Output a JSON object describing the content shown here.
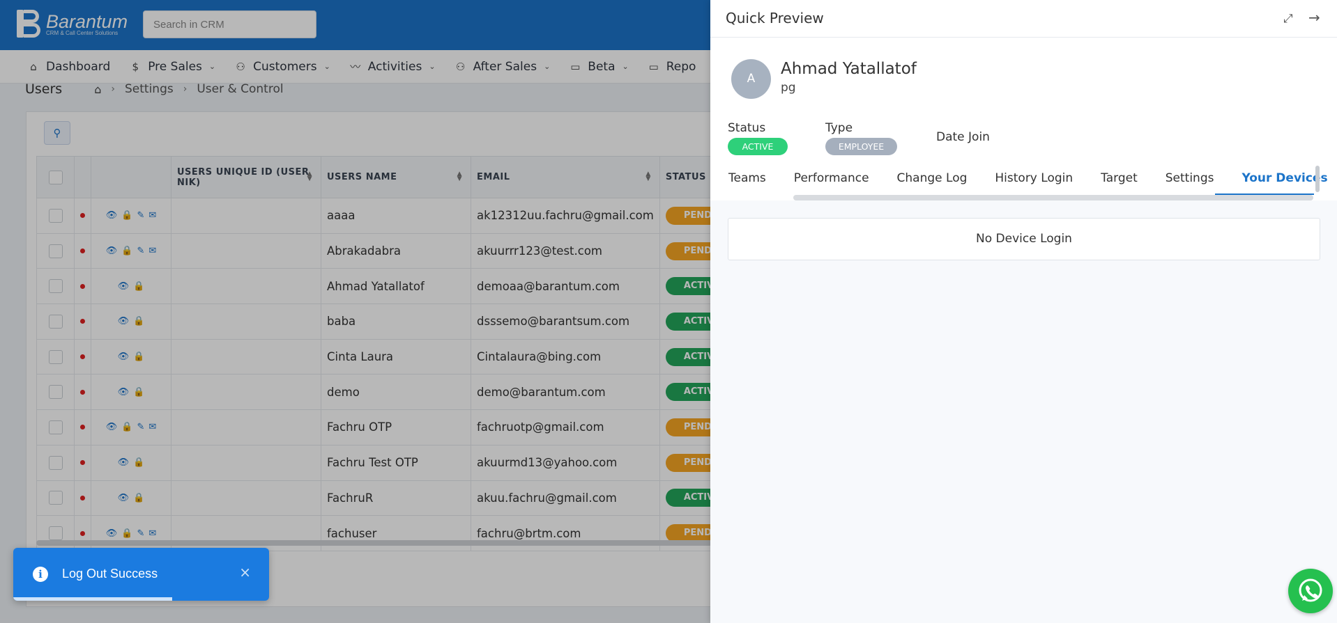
{
  "brand": {
    "name": "Barantum",
    "tagline": "CRM & Call Center Solutions"
  },
  "search": {
    "placeholder": "Search in CRM"
  },
  "nav": {
    "items": [
      {
        "label": "Dashboard",
        "icon": "home-icon",
        "glyph": "⌂",
        "caret": false
      },
      {
        "label": "Pre Sales",
        "icon": "dollar-icon",
        "glyph": "$",
        "caret": true
      },
      {
        "label": "Customers",
        "icon": "users-icon",
        "glyph": "⚇",
        "caret": true
      },
      {
        "label": "Activities",
        "icon": "activity-icon",
        "glyph": "〰",
        "caret": true
      },
      {
        "label": "After Sales",
        "icon": "user-service-icon",
        "glyph": "⚇",
        "caret": true
      },
      {
        "label": "Beta",
        "icon": "folder-icon",
        "glyph": "▭",
        "caret": true
      },
      {
        "label": "Repo",
        "icon": "folder-icon",
        "glyph": "▭",
        "caret": false
      }
    ]
  },
  "breadcrumb": {
    "title": "Users",
    "items": [
      "Settings",
      "User & Control"
    ]
  },
  "table": {
    "headers": [
      "USERS UNIQUE ID (USER NIK)",
      "USERS NAME",
      "EMAIL",
      "STATUS"
    ],
    "rows": [
      {
        "name": "aaaa",
        "email": "ak12312uu.fachru@gmail.com",
        "status": "PENDING",
        "status_type": "pending",
        "full_actions": true
      },
      {
        "name": "Abrakadabra",
        "email": "akuurrr123@test.com",
        "status": "PENDING",
        "status_type": "pending",
        "full_actions": true
      },
      {
        "name": "Ahmad Yatallatof",
        "email": "demoaa@barantum.com",
        "status": "ACTIVE",
        "status_type": "active",
        "full_actions": false
      },
      {
        "name": "baba",
        "email": "dsssemo@barantsum.com",
        "status": "ACTIVE",
        "status_type": "active",
        "full_actions": false
      },
      {
        "name": "Cinta Laura",
        "email": "Cintalaura@bing.com",
        "status": "ACTIVE",
        "status_type": "active",
        "full_actions": false
      },
      {
        "name": "demo",
        "email": "demo@barantum.com",
        "status": "ACTIVE",
        "status_type": "active",
        "full_actions": false
      },
      {
        "name": "Fachru OTP",
        "email": "fachruotp@gmail.com",
        "status": "PENDING",
        "status_type": "pending",
        "full_actions": true
      },
      {
        "name": "Fachru Test OTP",
        "email": "akuurmd13@yahoo.com",
        "status": "PENDING",
        "status_type": "pending",
        "full_actions": false
      },
      {
        "name": "FachruR",
        "email": "akuu.fachru@gmail.com",
        "status": "ACTIVE",
        "status_type": "active",
        "full_actions": false
      },
      {
        "name": "fachuser",
        "email": "fachru@brtm.com",
        "status": "PENDING",
        "status_type": "pending",
        "full_actions": true
      }
    ]
  },
  "toast": {
    "message": "Log Out Success",
    "close_label": "×",
    "progress": 0.62
  },
  "panel": {
    "title": "Quick Preview",
    "avatar_initial": "A",
    "user_name": "Ahmad Yatallatof",
    "user_sub": "pg",
    "status_label": "Status",
    "status_value": "ACTIVE",
    "type_label": "Type",
    "type_value": "EMPLOYEE",
    "date_join_label": "Date Join",
    "tabs": [
      "Teams",
      "Performance",
      "Change Log",
      "History Login",
      "Target",
      "Settings",
      "Your Devices"
    ],
    "active_tab": "Your Devices",
    "empty_message": "No Device Login"
  },
  "colors": {
    "primary": "#1c74c9",
    "active": "#2ed07a",
    "pending": "#f5a623",
    "whatsapp": "#25c04f"
  }
}
